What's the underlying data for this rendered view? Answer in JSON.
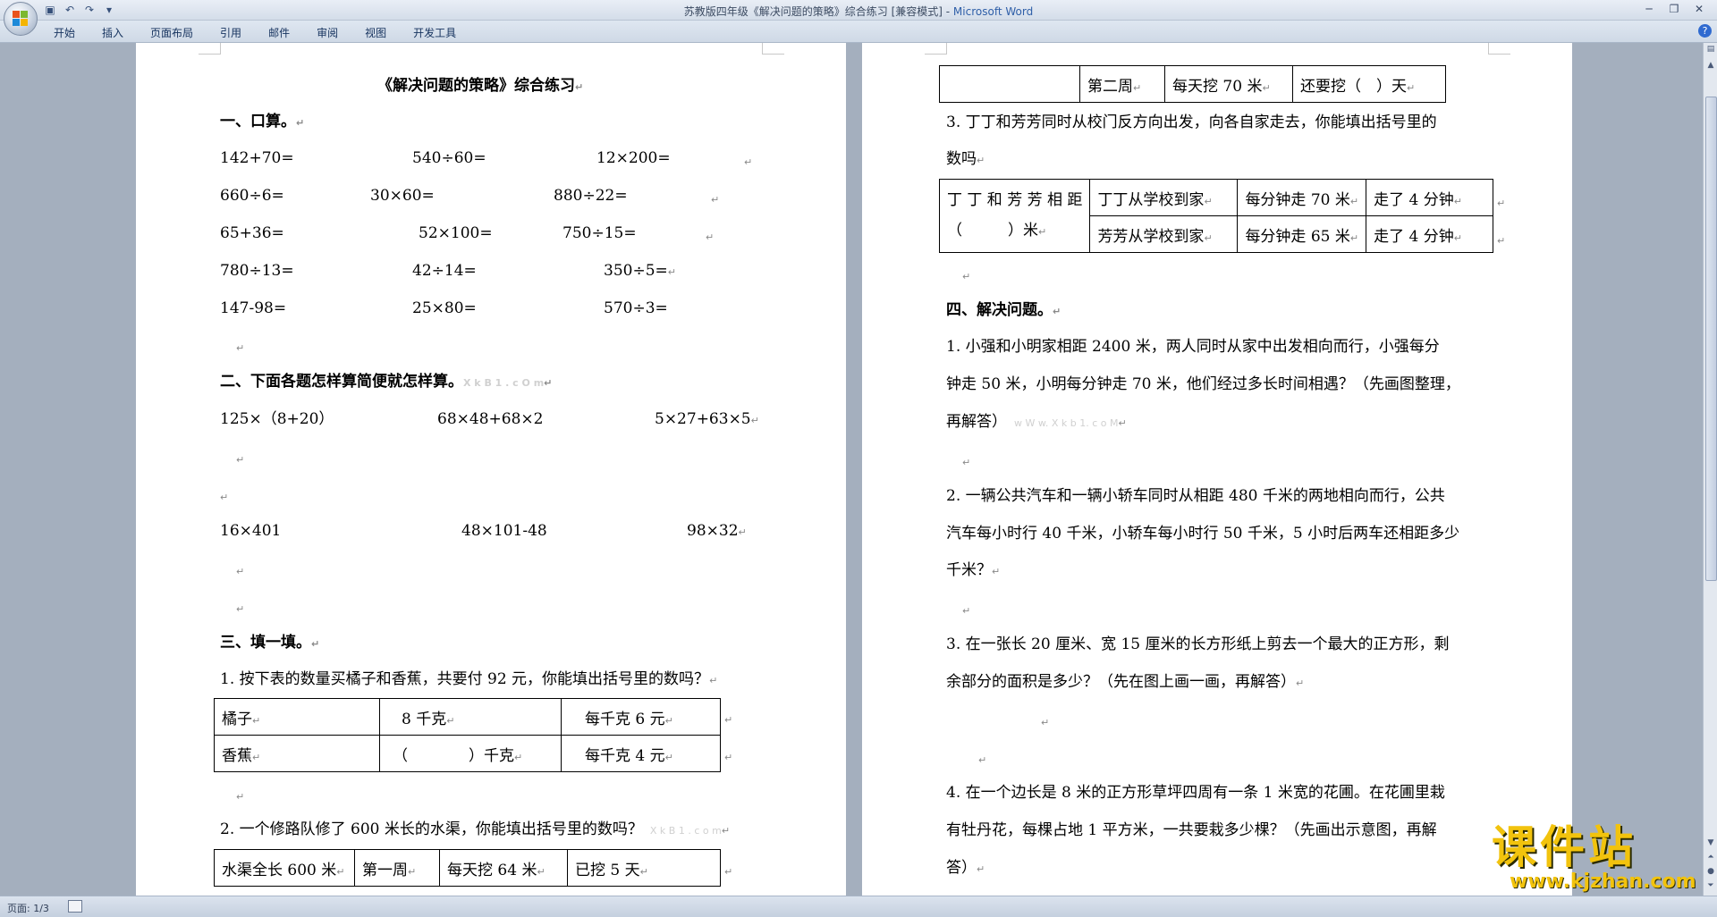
{
  "window": {
    "title_doc": "苏教版四年级《解决问题的策略》综合练习 [兼容模式] - ",
    "title_app": "Microsoft Word"
  },
  "ribbon": {
    "tabs": [
      "开始",
      "插入",
      "页面布局",
      "引用",
      "邮件",
      "审阅",
      "视图",
      "开发工具"
    ]
  },
  "status": {
    "page": "页面: 1/3"
  },
  "watermark": {
    "big": "课件站",
    "small": "www.kjzhan.com"
  },
  "page1": {
    "title": "《解决问题的策略》综合练习",
    "s1_heading": "一、口算。",
    "oral": [
      [
        "142+70=",
        "540÷60=",
        "12×200="
      ],
      [
        "660÷6=",
        "30×60=",
        "880÷22="
      ],
      [
        "65+36=",
        "52×100=",
        "750÷15="
      ],
      [
        "780÷13=",
        "42÷14=",
        "350÷5="
      ],
      [
        "147-98=",
        "25×80=",
        "570÷3="
      ]
    ],
    "s2_heading": "二、下面各题怎样算简便就怎样算。",
    "s2_ghost": "X k B 1 . c O m",
    "simplify_row1": [
      "125×（8+20）",
      "68×48+68×2",
      "5×27+63×5"
    ],
    "simplify_row2": [
      "16×401",
      "48×101-48",
      "98×32"
    ],
    "s3_heading": "三、填一填。",
    "q1": "1. 按下表的数量买橘子和香蕉，共要付 92 元，你能填出括号里的数吗？",
    "table1": [
      [
        "橘子",
        "8 千克",
        "每千克 6 元"
      ],
      [
        "香蕉",
        "（　　　　）千克",
        "每千克 4 元"
      ]
    ],
    "q2": "2. 一个修路队修了 600 米长的水渠，你能填出括号里的数吗？",
    "q2_ghost": "X k B 1 . c o m",
    "table2": [
      "水渠全长 600 米",
      "第一周",
      "每天挖 64 米",
      "已挖 5 天"
    ]
  },
  "page2": {
    "table2b": [
      "",
      "第二周",
      "每天挖 70 米",
      "还要挖（　）天"
    ],
    "q3_line1": "3. 丁丁和芳芳同时从校门反方向出发，向各自家走去，你能填出括号里的",
    "q3_line2": "数吗",
    "table3": {
      "merged_line1": "丁 丁 和 芳 芳 相 距",
      "merged_line2": "（　　　）米",
      "rows": [
        [
          "丁丁从学校到家",
          "每分钟走 70 米",
          "走了 4 分钟"
        ],
        [
          "芳芳从学校到家",
          "每分钟走 65 米",
          "走了 4 分钟"
        ]
      ]
    },
    "s4_heading": "四、解决问题。",
    "p1": [
      "1.  小强和小明家相距 2400 米，两人同时从家中出发相向而行，小强每分",
      "钟走 50 米，小明每分钟走 70 米，他们经过多长时间相遇？（先画图整理，",
      "再解答）"
    ],
    "p1_ghost": "w W w. X k b 1. c o M",
    "p2": [
      "2.  一辆公共汽车和一辆小轿车同时从相距 480 千米的两地相向而行，公共",
      "汽车每小时行 40 千米，小轿车每小时行 50 千米，5 小时后两车还相距多少",
      "千米？"
    ],
    "p3": [
      "3.  在一张长 20 厘米、宽 15 厘米的长方形纸上剪去一个最大的正方形，剩",
      "余部分的面积是多少？（先在图上画一画，再解答）"
    ],
    "p4": [
      "4.  在一个边长是 8 米的正方形草坪四周有一条 1 米宽的花圃。在花圃里栽",
      "有牡丹花，每棵占地  1  平方米，一共要栽多少棵？（先画出示意图，再解",
      "答）"
    ]
  },
  "marks": {
    "para": "↵"
  }
}
